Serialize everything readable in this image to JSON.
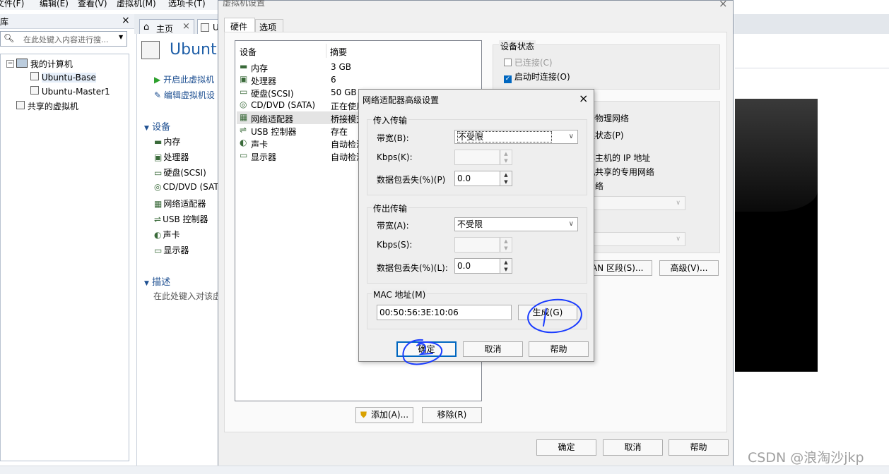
{
  "menubar": [
    "文件(F)",
    "编辑(E)",
    "查看(V)",
    "虚拟机(M)",
    "选项卡(T)"
  ],
  "library": {
    "title": "库",
    "search_placeholder": "在此处键入内容进行搜...",
    "tree": [
      "我的计算机",
      "Ubuntu-Base",
      "Ubuntu-Master1",
      "共享的虚拟机"
    ]
  },
  "tabs": {
    "home": "主页",
    "vm": "U"
  },
  "vm_page": {
    "title": "Ubuntu",
    "actions": [
      "开启此虚拟机",
      "编辑虚拟机设"
    ],
    "devices_header": "设备",
    "devices": [
      "内存",
      "处理器",
      "硬盘(SCSI)",
      "CD/DVD (SAT",
      "网络适配器",
      "USB 控制器",
      "声卡",
      "显示器"
    ],
    "desc_header": "描述",
    "desc_placeholder": "在此处键入对该虚"
  },
  "settings_dialog": {
    "title": "虚拟机设置",
    "tabs": [
      "硬件",
      "选项"
    ],
    "columns": [
      "设备",
      "摘要"
    ],
    "rows": [
      {
        "device": "内存",
        "summary": "3 GB"
      },
      {
        "device": "处理器",
        "summary": "6"
      },
      {
        "device": "硬盘(SCSI)",
        "summary": "50 GB"
      },
      {
        "device": "CD/DVD (SATA)",
        "summary": "正在使用"
      },
      {
        "device": "网络适配器",
        "summary": "桥接模式"
      },
      {
        "device": "USB 控制器",
        "summary": "存在"
      },
      {
        "device": "声卡",
        "summary": "自动检测"
      },
      {
        "device": "显示器",
        "summary": "自动检测"
      }
    ],
    "add_button": "添加(A)...",
    "remove_button": "移除(R)",
    "device_status": {
      "legend": "设备状态",
      "connected": "已连接(C)",
      "connect_at_power_on": "启动时连接(O)",
      "connected_checked": false,
      "connect_at_power_on_checked": true
    },
    "net_right_labels": [
      "接物理网络",
      "连状态(P)",
      "享主机的 IP 地址",
      "机共享的专用网络",
      "网络"
    ],
    "lan_segment_button": "LAN 区段(S)...",
    "advanced_button": "高级(V)...",
    "ok": "确定",
    "cancel": "取消",
    "help": "帮助"
  },
  "advanced_dialog": {
    "title": "网络适配器高级设置",
    "incoming": {
      "legend": "传入传输",
      "bandwidth_label": "带宽(B):",
      "bandwidth_value": "不受限",
      "kbps_label": "Kbps(K):",
      "kbps_value": "",
      "loss_label": "数据包丢失(%)(P)",
      "loss_value": "0.0"
    },
    "outgoing": {
      "legend": "传出传输",
      "bandwidth_label": "带宽(A):",
      "bandwidth_value": "不受限",
      "kbps_label": "Kbps(S):",
      "kbps_value": "",
      "loss_label": "数据包丢失(%)(L):",
      "loss_value": "0.0"
    },
    "mac": {
      "legend": "MAC 地址(M)",
      "value": "00:50:56:3E:10:06",
      "generate_button": "生成(G)"
    },
    "ok": "确定",
    "cancel": "取消",
    "help": "帮助"
  },
  "annotations": {
    "mark_1": "1",
    "mark_2": "2",
    "ink_color": "#1a3cff"
  },
  "watermark": "CSDN @浪淘沙jkp"
}
